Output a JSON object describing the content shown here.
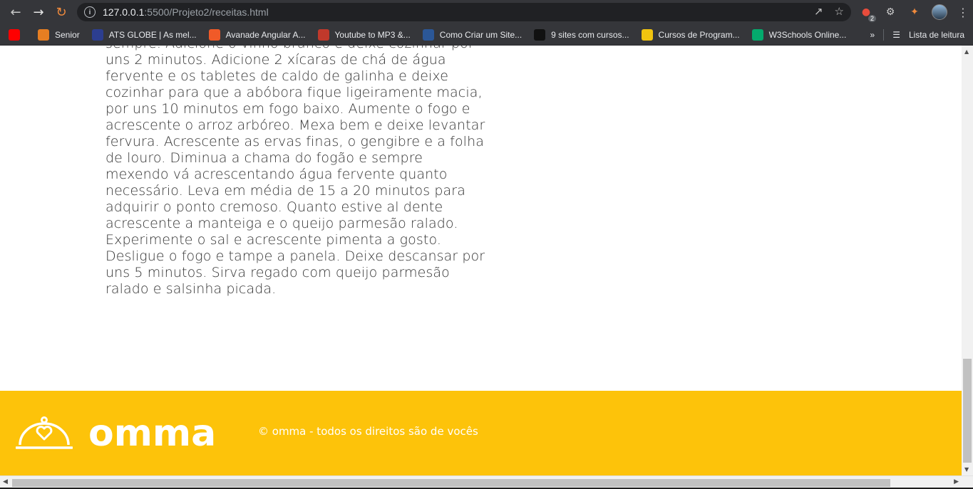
{
  "browser": {
    "url_host": "127.0.0.1",
    "url_path": ":5500/Projeto2/receitas.html",
    "tab_badge": "2"
  },
  "bookmarks": [
    {
      "label": "",
      "icon": "youtube-icon",
      "color": "#ff0000"
    },
    {
      "label": "Senior",
      "icon": "senior-icon",
      "color": "#e67e22"
    },
    {
      "label": "ATS GLOBE | As mel...",
      "icon": "globe-icon",
      "color": "#2c3e90"
    },
    {
      "label": "Avanade Angular A...",
      "icon": "avanade-icon",
      "color": "#f05a28"
    },
    {
      "label": "Youtube to MP3 &...",
      "icon": "mp3-icon",
      "color": "#c0392b"
    },
    {
      "label": "Como Criar um Site...",
      "icon": "word-icon",
      "color": "#2b5797"
    },
    {
      "label": "9 sites com cursos...",
      "icon": "six-icon",
      "color": "#111111"
    },
    {
      "label": "Cursos de Program...",
      "icon": "cursos-icon",
      "color": "#f1c40f"
    },
    {
      "label": "W3Schools Online...",
      "icon": "w3schools-icon",
      "color": "#04aa6d"
    }
  ],
  "bookmarks_overflow": "»",
  "reading_list_label": "Lista de leitura",
  "recipe": {
    "lines": [
      "sempre. Adicione o vinho branco e deixe cozinhar por",
      "uns 2 minutos. Adicione 2 xícaras de chá de água",
      "fervente e os tabletes de caldo de galinha e deixe",
      "cozinhar para que a abóbora fique ligeiramente macia,",
      "por uns 10 minutos em fogo baixo. Aumente o fogo e",
      "acrescente o arroz arbóreo. Mexa bem e deixe levantar",
      "fervura. Acrescente as ervas finas, o gengibre e a folha",
      "de louro. Diminua a chama do fogão e sempre",
      "mexendo vá acrescentando água fervente quanto",
      "necessário. Leva em média de 15 a 20 minutos para",
      "adquirir o ponto cremoso. Quanto estive al dente",
      "acrescente a manteiga e o queijo parmesão ralado.",
      "Experimente o sal e acrescente pimenta a gosto.",
      "Desligue o fogo e tampe a panela. Deixe descansar por",
      "uns 5 minutos. Sirva regado com queijo parmesão",
      "ralado e salsinha picada."
    ]
  },
  "footer": {
    "logo_text": "omma",
    "copyright": "© omma - todos os direitos são de vocês",
    "background": "#fdc30a"
  }
}
